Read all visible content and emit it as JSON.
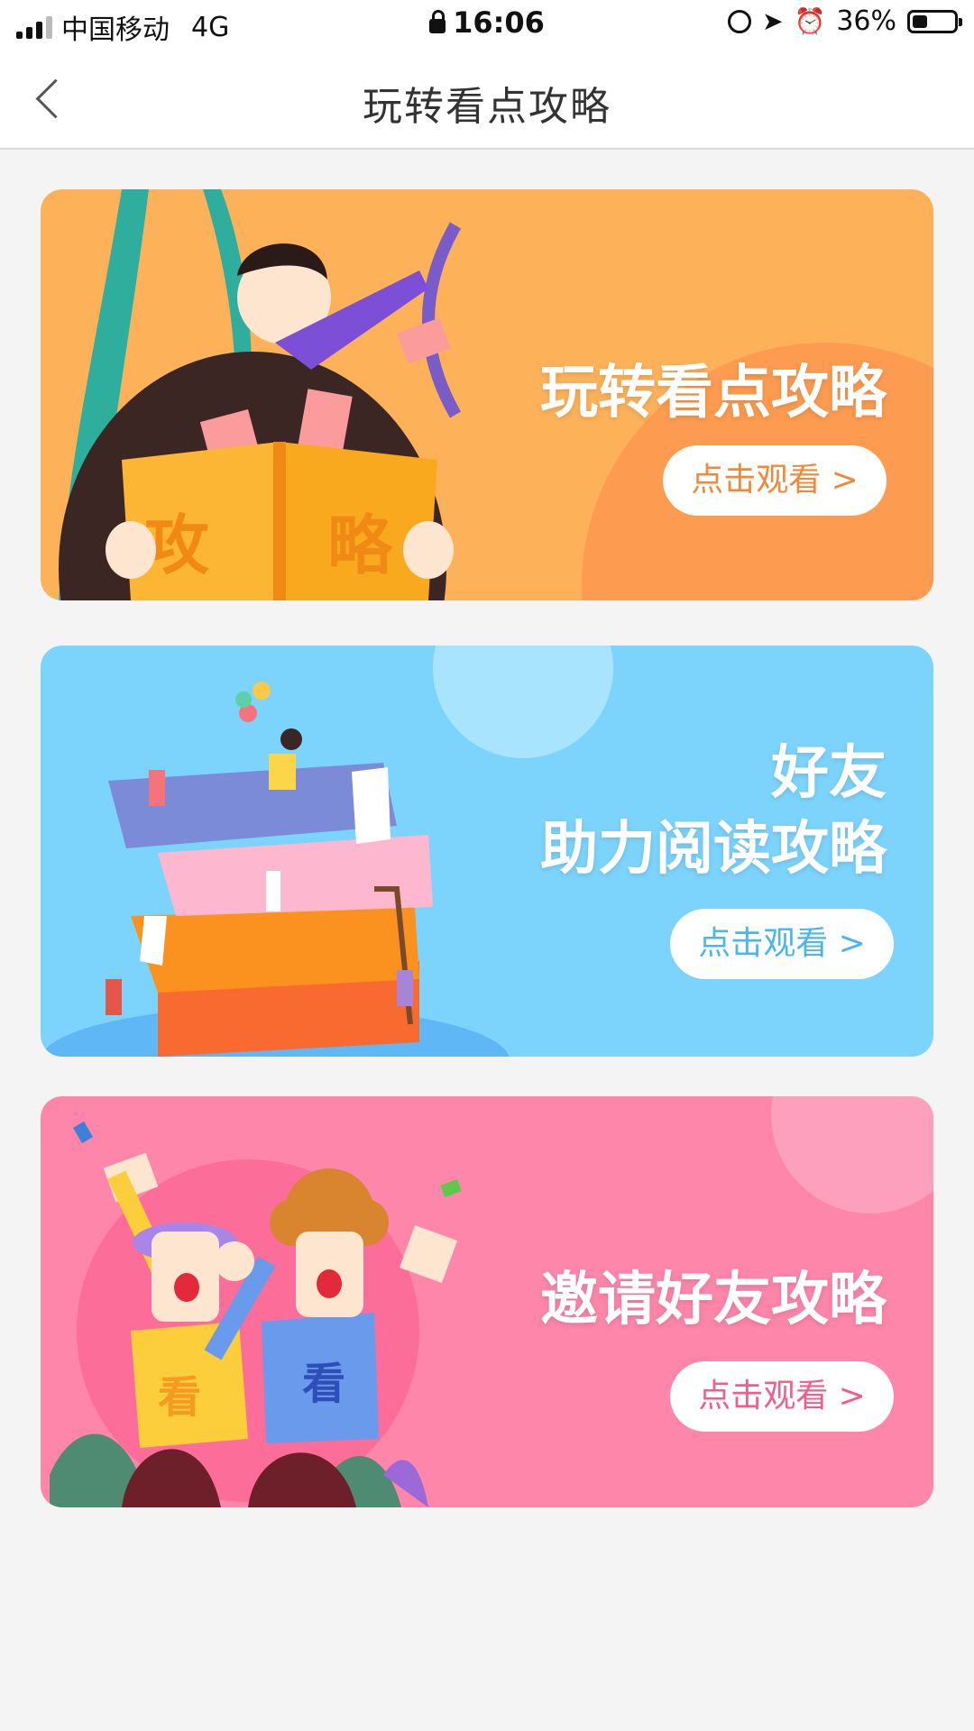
{
  "status_bar": {
    "carrier": "中国移动",
    "network": "4G",
    "time": "16:06",
    "battery": "36%",
    "battery_level": 0.36
  },
  "nav": {
    "back_icon": "chevron-left-icon",
    "title": "玩转看点攻略"
  },
  "cards": [
    {
      "title_lines": [
        "玩转看点攻略"
      ],
      "button_label": "点击观看 >",
      "color": "#fdb25a",
      "book_chars": [
        "攻",
        "略"
      ]
    },
    {
      "title_lines": [
        "好友",
        "助力阅读攻略"
      ],
      "button_label": "点击观看 >",
      "color": "#7cd4fd"
    },
    {
      "title_lines": [
        "邀请好友攻略"
      ],
      "button_label": "点击观看 >",
      "color": "#fe86aa",
      "shirt_chars": [
        "看",
        "看"
      ]
    }
  ]
}
